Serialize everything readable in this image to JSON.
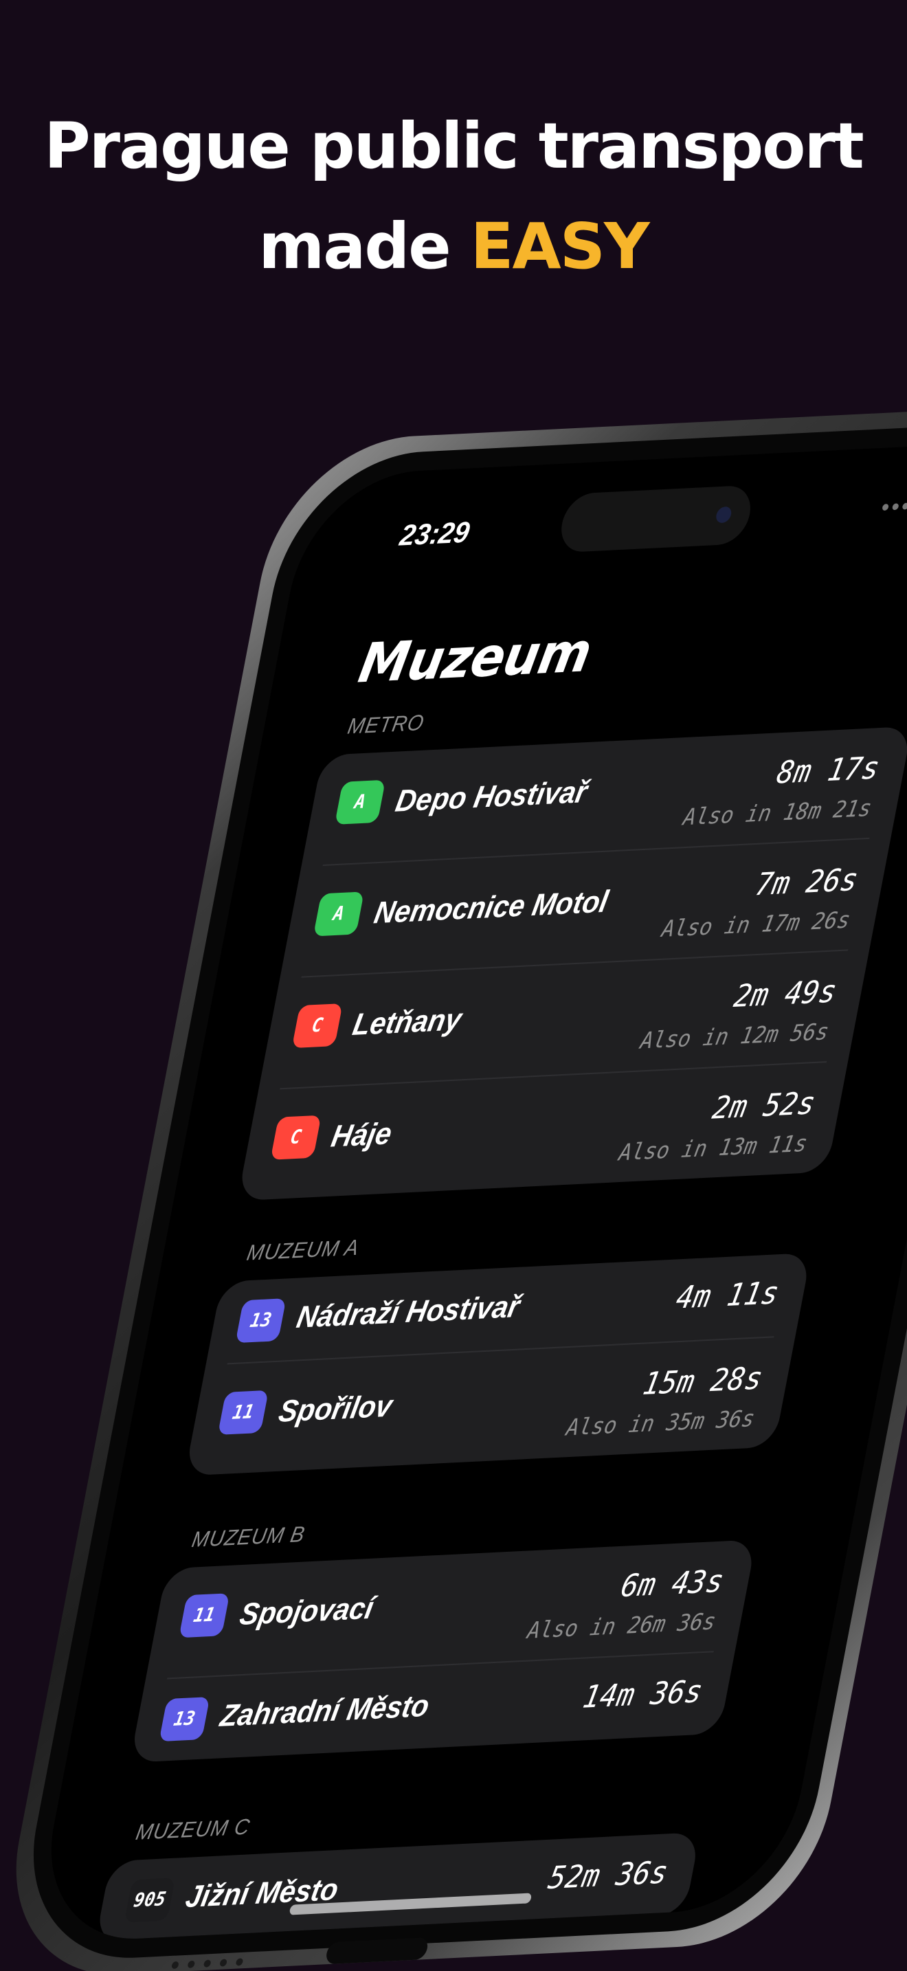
{
  "headline": {
    "line1": "Prague public transport",
    "line2_prefix": "made ",
    "line2_accent": "EASY"
  },
  "colors": {
    "accent": "#f7b52b",
    "background": "#150a18",
    "line_a": "#34c759",
    "line_c": "#ff453a",
    "tram": "#5e5ce6",
    "bus": "#1c1c1e"
  },
  "status_bar": {
    "time": "23:29",
    "icons": [
      "cellular-dots-icon",
      "wifi-icon",
      "battery-icon"
    ]
  },
  "stop": {
    "name": "Muzeum"
  },
  "sections": [
    {
      "label": "METRO",
      "departures": [
        {
          "line": "A",
          "kind": "metro-a",
          "destination": "Depo Hostivař",
          "eta": "8m 17s",
          "also": "Also in 18m 21s"
        },
        {
          "line": "A",
          "kind": "metro-a",
          "destination": "Nemocnice Motol",
          "eta": "7m 26s",
          "also": "Also in 17m 26s"
        },
        {
          "line": "C",
          "kind": "metro-c",
          "destination": "Letňany",
          "eta": "2m 49s",
          "also": "Also in 12m 56s"
        },
        {
          "line": "C",
          "kind": "metro-c",
          "destination": "Háje",
          "eta": "2m 52s",
          "also": "Also in 13m 11s"
        }
      ]
    },
    {
      "label": "MUZEUM A",
      "departures": [
        {
          "line": "13",
          "kind": "tram",
          "destination": "Nádraží Hostivař",
          "eta": "4m 11s",
          "also": ""
        },
        {
          "line": "11",
          "kind": "tram",
          "destination": "Spořilov",
          "eta": "15m 28s",
          "also": "Also in 35m 36s"
        }
      ]
    },
    {
      "label": "MUZEUM B",
      "departures": [
        {
          "line": "11",
          "kind": "tram",
          "destination": "Spojovací",
          "eta": "6m 43s",
          "also": "Also in 26m 36s"
        },
        {
          "line": "13",
          "kind": "tram",
          "destination": "Zahradní Město",
          "eta": "14m 36s",
          "also": ""
        }
      ]
    },
    {
      "label": "MUZEUM C",
      "departures": [
        {
          "line": "905",
          "kind": "bus",
          "destination": "Jižní Město",
          "eta": "52m 36s",
          "also": ""
        }
      ]
    }
  ]
}
